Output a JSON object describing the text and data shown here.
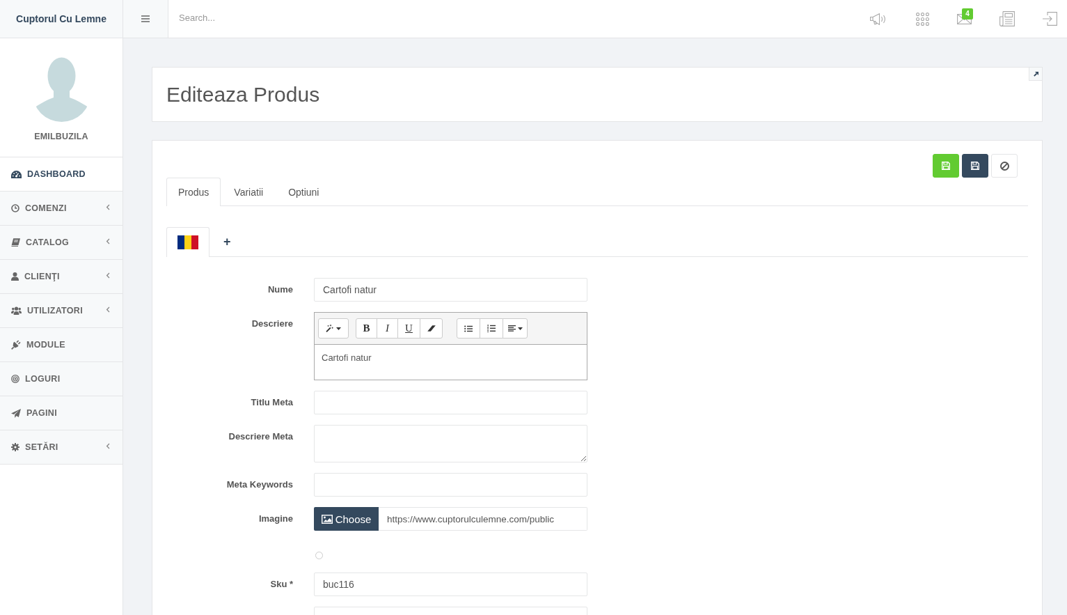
{
  "brand": "Cuptorul Cu Lemne",
  "search": {
    "placeholder": "Search..."
  },
  "notifications": {
    "mail_count": "4"
  },
  "user": {
    "name": "EMILBUZILA"
  },
  "sidebar": {
    "items": [
      {
        "label": "DASHBOARD",
        "selected": true,
        "submenu": false
      },
      {
        "label": "COMENZI",
        "selected": false,
        "submenu": true
      },
      {
        "label": "CATALOG",
        "selected": false,
        "submenu": true
      },
      {
        "label": "CLIENŢI",
        "selected": false,
        "submenu": true
      },
      {
        "label": "UTILIZATORI",
        "selected": false,
        "submenu": true
      },
      {
        "label": "MODULE",
        "selected": false,
        "submenu": false
      },
      {
        "label": "LOGURI",
        "selected": false,
        "submenu": false
      },
      {
        "label": "PAGINI",
        "selected": false,
        "submenu": false
      },
      {
        "label": "SETĂRI",
        "selected": false,
        "submenu": true
      }
    ]
  },
  "page_title": "Editeaza Produs",
  "actions": [
    {
      "kind": "save"
    },
    {
      "kind": "save"
    },
    {
      "kind": "cancel"
    }
  ],
  "tabs": [
    {
      "label": "Produs",
      "selected": true
    },
    {
      "label": "Variatii",
      "selected": false
    },
    {
      "label": "Optiuni",
      "selected": false
    }
  ],
  "language_tabs": [
    {
      "kind": "flag",
      "selected": true
    },
    {
      "kind": "add",
      "label": "+",
      "selected": false
    }
  ],
  "form": {
    "fields": [
      {
        "kind": "text",
        "label": "Nume",
        "value": "Cartofi natur"
      },
      {
        "kind": "editor",
        "label": "Descriere",
        "toolbar": [
          [
            {
              "kind": "style"
            }
          ],
          [
            {
              "kind": "bold",
              "label": "B"
            },
            {
              "kind": "italic",
              "label": "I"
            },
            {
              "kind": "underline",
              "label": "U"
            },
            {
              "kind": "eraser"
            }
          ],
          [
            {
              "kind": "unordered-list"
            },
            {
              "kind": "ordered-list"
            },
            {
              "kind": "align"
            }
          ]
        ],
        "value": "Cartofi natur"
      },
      {
        "kind": "text",
        "label": "Titlu Meta"
      },
      {
        "kind": "textarea",
        "label": "Descriere Meta"
      },
      {
        "kind": "text",
        "label": "Meta Keywords"
      },
      {
        "kind": "file",
        "label": "Imagine",
        "button": "Choose",
        "value": "https://www.cuptorulculemne.com/public"
      },
      {
        "kind": "radio",
        "checked": false
      },
      {
        "kind": "text",
        "label": "Sku *",
        "value": "buc116"
      },
      {
        "kind": "text"
      }
    ]
  }
}
